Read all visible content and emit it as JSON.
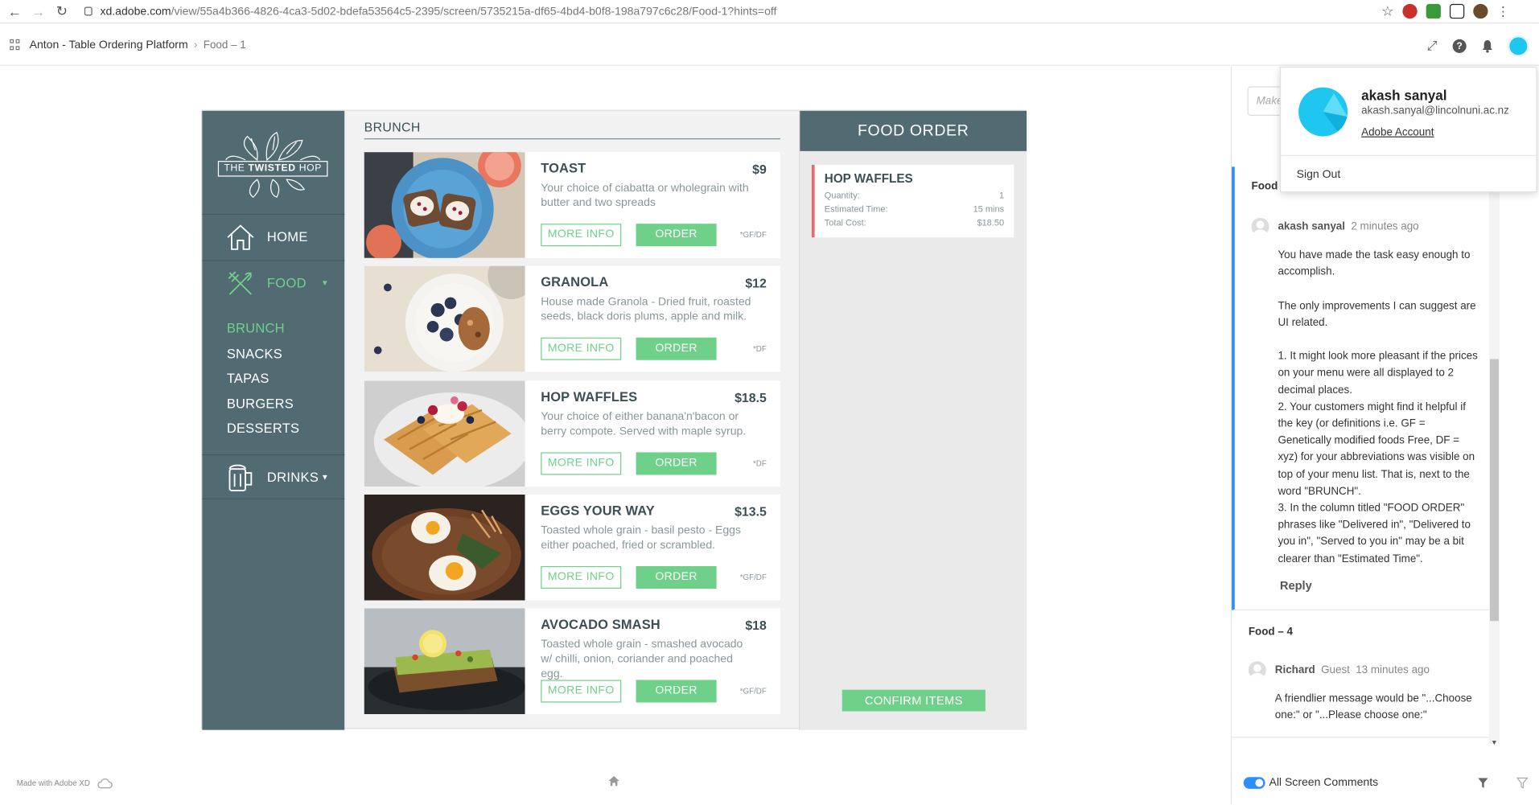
{
  "browser": {
    "url_host": "xd.adobe.com",
    "url_path": "/view/55a4b366-4826-4ca3-5d02-bdefa53564c5-2395/screen/5735215a-df65-4bd4-b0f8-198a797c6c28/Food-1?hints=off"
  },
  "header": {
    "breadcrumb_project": "Anton - Table Ordering Platform",
    "breadcrumb_screen": "Food – 1"
  },
  "app": {
    "logo_prefix": "THE",
    "logo_main": "TWISTED",
    "logo_suffix": "HOP",
    "nav": [
      {
        "label": "HOME"
      },
      {
        "label": "FOOD"
      },
      {
        "label": "DRINKS"
      }
    ],
    "subnav": [
      "BRUNCH",
      "SNACKS",
      "TAPAS",
      "BURGERS",
      "DESSERTS"
    ],
    "section_title": "BRUNCH",
    "more_info_label": "MORE INFO",
    "order_label": "ORDER",
    "items": [
      {
        "name": "TOAST",
        "price": "$9",
        "desc": "Your choice of ciabatta or wholegrain with butter and two spreads",
        "tag": "*GF/DF"
      },
      {
        "name": "GRANOLA",
        "price": "$12",
        "desc": "House made Granola - Dried fruit, roasted seeds, black doris plums, apple and milk.",
        "tag": "*DF"
      },
      {
        "name": "HOP WAFFLES",
        "price": "$18.5",
        "desc": "Your choice of either banana'n'bacon or berry compote. Served with maple syrup.",
        "tag": "*DF"
      },
      {
        "name": "EGGS YOUR WAY",
        "price": "$13.5",
        "desc": "Toasted whole grain - basil pesto - Eggs either poached, fried or scrambled.",
        "tag": "*GF/DF"
      },
      {
        "name": "AVOCADO SMASH",
        "price": "$18",
        "desc": "Toasted whole grain - smashed avocado w/ chilli, onion, coriander and poached egg.",
        "tag": "*GF/DF"
      }
    ],
    "order_panel": {
      "title": "FOOD ORDER",
      "item_name": "HOP WAFFLES",
      "quantity_label": "Quantity:",
      "quantity": "1",
      "time_label": "Estimated Time:",
      "time": "15 mins",
      "cost_label": "Total Cost:",
      "cost": "$18.50",
      "confirm_label": "CONFIRM ITEMS"
    }
  },
  "footer": {
    "made_with": "Made with Adobe XD"
  },
  "comments": {
    "input_placeholder": "Make",
    "thread1": {
      "title": "Food –",
      "author": "akash sanyal",
      "time": "2 minutes ago",
      "body": "You have made the task easy enough to accomplish.\n\nThe only improvements I can suggest are UI related.\n\n1. It might look more pleasant if the prices on your menu were all displayed to 2 decimal places.\n2. Your customers might find it helpful if the key (or definitions i.e. GF = Genetically modified foods Free, DF = xyz) for your abbreviations was visible on top of your menu list. That is, next to the word \"BRUNCH\".\n3. In the column titled \"FOOD ORDER\" phrases like \"Delivered in\", \"Delivered to you in\", \"Served to you in\" may be a bit clearer than \"Estimated Time\".",
      "reply_label": "Reply"
    },
    "thread2": {
      "title": "Food – 4",
      "author": "Richard",
      "role": "Guest",
      "time": "13 minutes ago",
      "body": "A friendlier message would be \"...Choose one:\" or \"...Please choose one:\""
    },
    "all_screen_label": "All Screen Comments"
  },
  "account": {
    "name": "akash sanyal",
    "email": "akash.sanyal@lincolnuni.ac.nz",
    "link": "Adobe Account",
    "sign_out": "Sign Out"
  },
  "colors": {
    "sidebar": "#526b72",
    "accent_green": "#6fd08a",
    "thread_blue": "#2d8ef5",
    "avatar_cyan": "#1fc6ef"
  }
}
